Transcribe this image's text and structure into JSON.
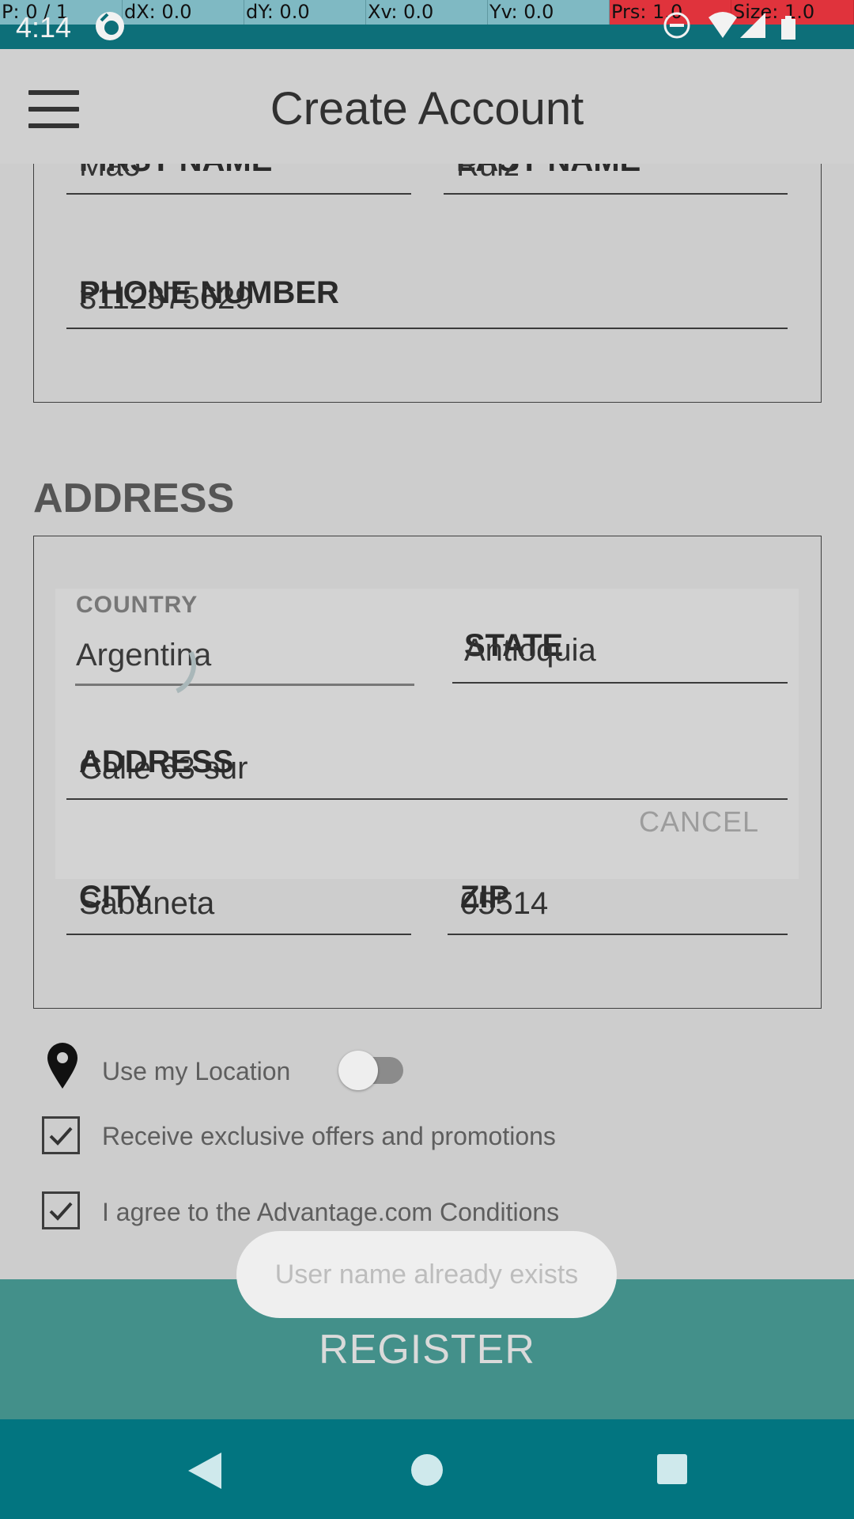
{
  "debug": {
    "pointer": "P: 0 / 1",
    "dx": "dX: 0.0",
    "dy": "dY: 0.0",
    "xv": "Xv: 0.0",
    "yv": "Yv: 0.0",
    "prs": "Prs: 1.0",
    "size": "Size: 1.0"
  },
  "status": {
    "time": "4:14"
  },
  "appbar": {
    "title": "Create Account",
    "menu_icon": "hamburger-menu-icon"
  },
  "account_details": {
    "first_name_label": "FIRST NAME",
    "first_name_value": "Mao",
    "last_name_label": "LAST NAME",
    "last_name_value": "Ruiz",
    "phone_label": "PHONE NUMBER",
    "phone_value": "3112375629"
  },
  "address_section": {
    "title": "ADDRESS",
    "state_label": "STATE",
    "state_value": "Antioquia",
    "address_label": "ADDRESS",
    "address_value": "Calle 63 sur",
    "city_label": "CITY",
    "city_value": "Sabaneta",
    "zip_label": "ZIP",
    "zip_value": "05514"
  },
  "country_dialog": {
    "label": "COUNTRY",
    "value": "Argentina",
    "cancel_label": "CANCEL"
  },
  "options": {
    "location_label": "Use my Location",
    "location_enabled": false,
    "offers_label": "Receive exclusive offers and promotions",
    "offers_checked": true,
    "agree_label": "I agree to the Advantage.com Conditions",
    "agree_checked": true
  },
  "toast": {
    "message": "User name already exists"
  },
  "register": {
    "label": "REGISTER"
  },
  "colors": {
    "status_bar": "#0d6f79",
    "register_button": "#43908a",
    "nav_bar": "#027580",
    "debug_bar": "#7fb9c3",
    "debug_alert": "#e0333c"
  }
}
